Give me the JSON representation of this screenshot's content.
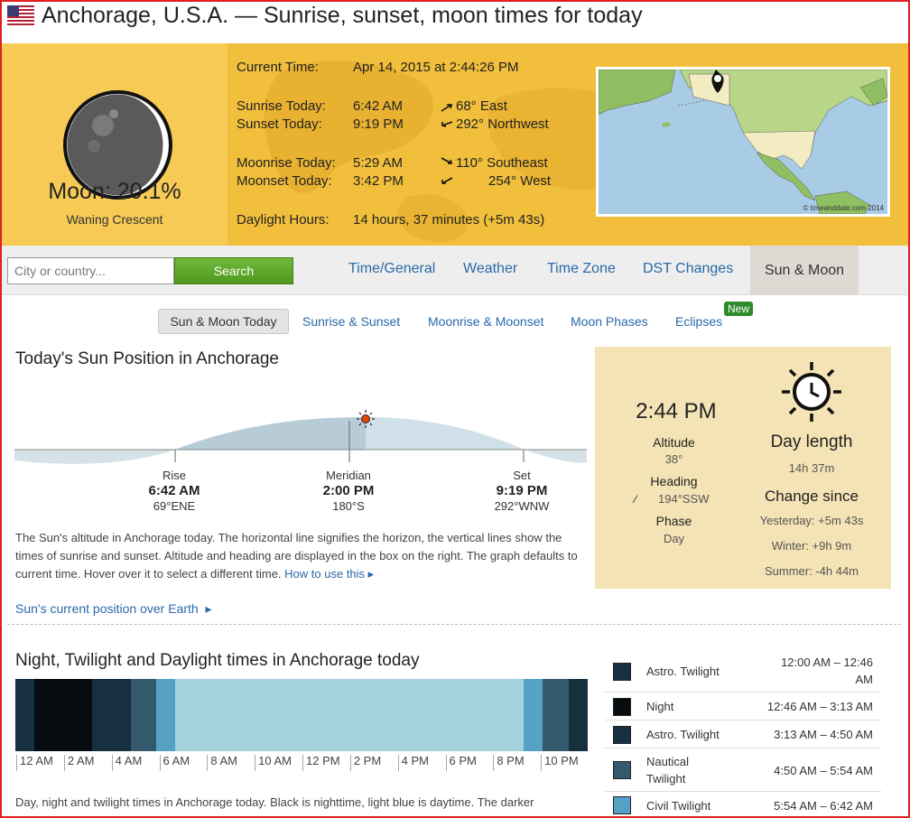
{
  "header": {
    "title": "Anchorage, U.S.A. — Sunrise, sunset, moon times for today"
  },
  "moon": {
    "title": "Moon: 20.1%",
    "phase": "Waning Crescent",
    "illumination_fraction": 0.201
  },
  "info": {
    "current_time_label": "Current Time:",
    "current_time": "Apr 14, 2015 at 2:44:26 PM",
    "sunrise_label": "Sunrise Today:",
    "sunrise": "6:42 AM",
    "sunrise_dir": "68° East",
    "sunset_label": "Sunset Today:",
    "sunset": "9:19 PM",
    "sunset_dir": "292° Northwest",
    "moonrise_label": "Moonrise Today:",
    "moonrise": "5:29 AM",
    "moonrise_dir": "110° Southeast",
    "moonset_label": "Moonset Today:",
    "moonset": "3:42 PM",
    "moonset_dir": "254° West",
    "daylight_label": "Daylight Hours:",
    "daylight": "14 hours, 37 minutes (+5m 43s)"
  },
  "map": {
    "copyright": "© timeanddate.com 2014"
  },
  "search": {
    "placeholder": "City or country...",
    "button": "Search"
  },
  "nav": {
    "tabs": [
      "Time/General",
      "Weather",
      "Time Zone",
      "DST Changes",
      "Sun & Moon"
    ],
    "active": "Sun & Moon"
  },
  "subnav": {
    "tabs": [
      "Sun & Moon Today",
      "Sunrise & Sunset",
      "Moonrise & Moonset",
      "Moon Phases",
      "Eclipses"
    ],
    "badge": "New"
  },
  "sun_position": {
    "title": "Today's Sun Position in Anchorage",
    "rise": {
      "label": "Rise",
      "time": "6:42 AM",
      "dir": "69°ENE"
    },
    "meridian": {
      "label": "Meridian",
      "time": "2:00 PM",
      "dir": "180°S"
    },
    "set": {
      "label": "Set",
      "time": "9:19 PM",
      "dir": "292°WNW"
    },
    "description": "The Sun's altitude in Anchorage today. The horizontal line signifies the horizon, the vertical lines show the times of sunrise and sunset. Altitude and heading are displayed in the box on the right. The graph defaults to current time. Hover over it to select a different time.",
    "how_to_link": "How to use this",
    "earth_link": "Sun's current position over Earth"
  },
  "sun_panel": {
    "time": "2:44 PM",
    "altitude_label": "Altitude",
    "altitude": "38°",
    "heading_label": "Heading",
    "heading": "194°SSW",
    "phase_label": "Phase",
    "phase": "Day",
    "day_length_label": "Day length",
    "day_length": "14h 37m",
    "change_label": "Change since",
    "yesterday": "Yesterday: +5m 43s",
    "winter": "Winter: +9h 9m",
    "summer": "Summer: -4h 44m"
  },
  "twilight": {
    "title": "Night, Twilight and Daylight times in Anchorage today",
    "ticks": [
      "12 AM",
      "2 AM",
      "4 AM",
      "6 AM",
      "8 AM",
      "10 AM",
      "12 PM",
      "2 PM",
      "4 PM",
      "6 PM",
      "8 PM",
      "10 PM"
    ],
    "description": "Day, night and twilight times in Anchorage today. Black is nighttime, light blue is daytime. The darker",
    "segments": [
      {
        "type": "Astro. Twilight",
        "start_h": 0.0,
        "end_h": 0.78
      },
      {
        "type": "Night",
        "start_h": 0.78,
        "end_h": 3.22
      },
      {
        "type": "Astro. Twilight",
        "start_h": 3.22,
        "end_h": 4.83
      },
      {
        "type": "Nautical Twilight",
        "start_h": 4.83,
        "end_h": 5.9
      },
      {
        "type": "Civil Twilight",
        "start_h": 5.9,
        "end_h": 6.7
      },
      {
        "type": "Daylight",
        "start_h": 6.7,
        "end_h": 21.32
      },
      {
        "type": "Civil Twilight",
        "start_h": 21.32,
        "end_h": 22.1
      },
      {
        "type": "Nautical Twilight",
        "start_h": 22.1,
        "end_h": 23.2
      },
      {
        "type": "Astro. Twilight",
        "start_h": 23.2,
        "end_h": 24.0
      }
    ],
    "colors": {
      "Night": "#070c10",
      "Astro. Twilight": "#17303f",
      "Nautical Twilight": "#35596c",
      "Civil Twilight": "#55a2c6",
      "Daylight": "#a5d1dd"
    },
    "legend": [
      {
        "name": "Astro. Twilight",
        "time": "12:00 AM – 12:46 AM"
      },
      {
        "name": "Night",
        "time": "12:46 AM – 3:13 AM"
      },
      {
        "name": "Astro. Twilight",
        "time": "3:13 AM – 4:50 AM"
      },
      {
        "name": "Nautical Twilight",
        "time": "4:50 AM – 5:54 AM"
      },
      {
        "name": "Civil Twilight",
        "time": "5:54 AM – 6:42 AM"
      }
    ]
  }
}
